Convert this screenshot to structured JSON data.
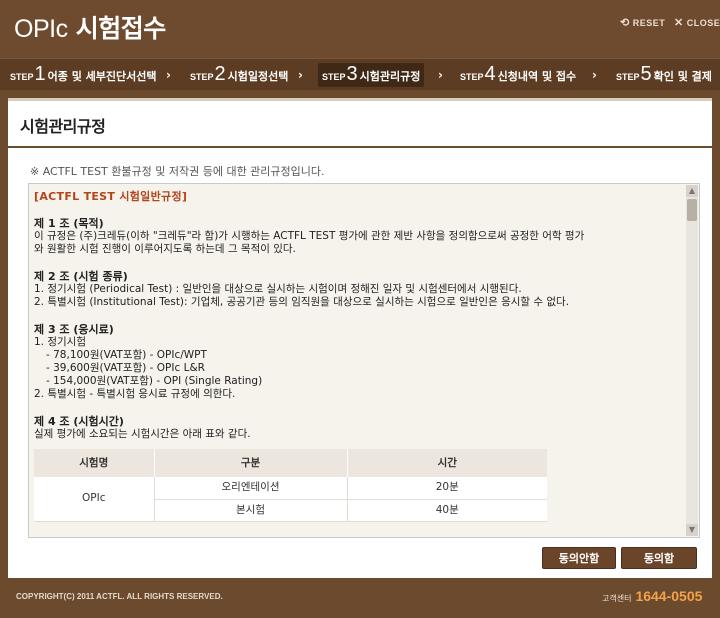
{
  "header": {
    "title_latin": "OPIc",
    "title_ko": " 시험접수",
    "reset_label": "RESET",
    "close_label": "CLOSE",
    "reset_icon": "reset-icon",
    "close_icon": "close-icon"
  },
  "steps": [
    {
      "prefix": "STEP",
      "num": "1",
      "label": "어종 및 세부진단서선택"
    },
    {
      "prefix": "STEP",
      "num": "2",
      "label": "시험일정선택"
    },
    {
      "prefix": "STEP",
      "num": "3",
      "label": "시험관리규정"
    },
    {
      "prefix": "STEP",
      "num": "4",
      "label": "신청내역 및 접수"
    },
    {
      "prefix": "STEP",
      "num": "5",
      "label": "확인 및 결제"
    }
  ],
  "panel": {
    "title": "시험관리규정",
    "notice": "※ ACTFL TEST 환불규정 및 저작권 등에 대한 관리규정입니다."
  },
  "terms": {
    "doc_title": "[ACTFL TEST 시험일반규정]",
    "art1_h": "제 1 조 (목적)",
    "art1_l1": "이 규정은 (주)크레듀(이하 \"크레듀\"라 함)가 시행하는 ACTFL TEST 평가에 관한 제반 사항을 정의함으로써 공정한 어학 평가",
    "art1_l2": "와 원활한 시험 진행이 이루어지도록 하는데 그 목적이 있다.",
    "art2_h": "제 2 조 (시험 종류)",
    "art2_l1": "1. 정기시험 (Periodical Test) : 일반인을 대상으로 실시하는 시험이며 정해진 일자 및 시험센터에서 시행된다.",
    "art2_l2": "2. 특별시험 (Institutional Test): 기업체, 공공기관 등의 임직원을 대상으로 실시하는 시험으로 일반인은 응시할 수 없다.",
    "art3_h": "제 3 조 (응시료)",
    "art3_l1": "1. 정기시험",
    "art3_l2": "- 78,100원(VAT포함) - OPIc/WPT",
    "art3_l3": "- 39,600원(VAT포함) - OPIc L&R",
    "art3_l4": "- 154,000원(VAT포함) - OPI (Single Rating)",
    "art3_l5": "2. 특별시험 - 특별시험 응시료 규정에 의한다.",
    "art4_h": "제 4 조 (시험시간)",
    "art4_l1": "실제 평가에 소요되는 시험시간은 아래 표와 같다.",
    "table": {
      "headers": [
        "시험명",
        "구분",
        "시간"
      ],
      "exam_name": "OPIc",
      "rows": [
        {
          "type": "오리엔테이션",
          "time": "20분"
        },
        {
          "type": "본시험",
          "time": "40분"
        }
      ]
    }
  },
  "buttons": {
    "disagree": "동의안함",
    "agree": "동의함"
  },
  "footer": {
    "copyright": "COPYRIGHT(C) 2011 ACTFL. ALL RIGHTS RESERVED.",
    "cs_label": "고객센터",
    "cs_number": "1644-0505"
  },
  "colors": {
    "brand_brown": "#6e4b2e",
    "accent_orange": "#b3451b",
    "phone_orange": "#f3a24a"
  }
}
